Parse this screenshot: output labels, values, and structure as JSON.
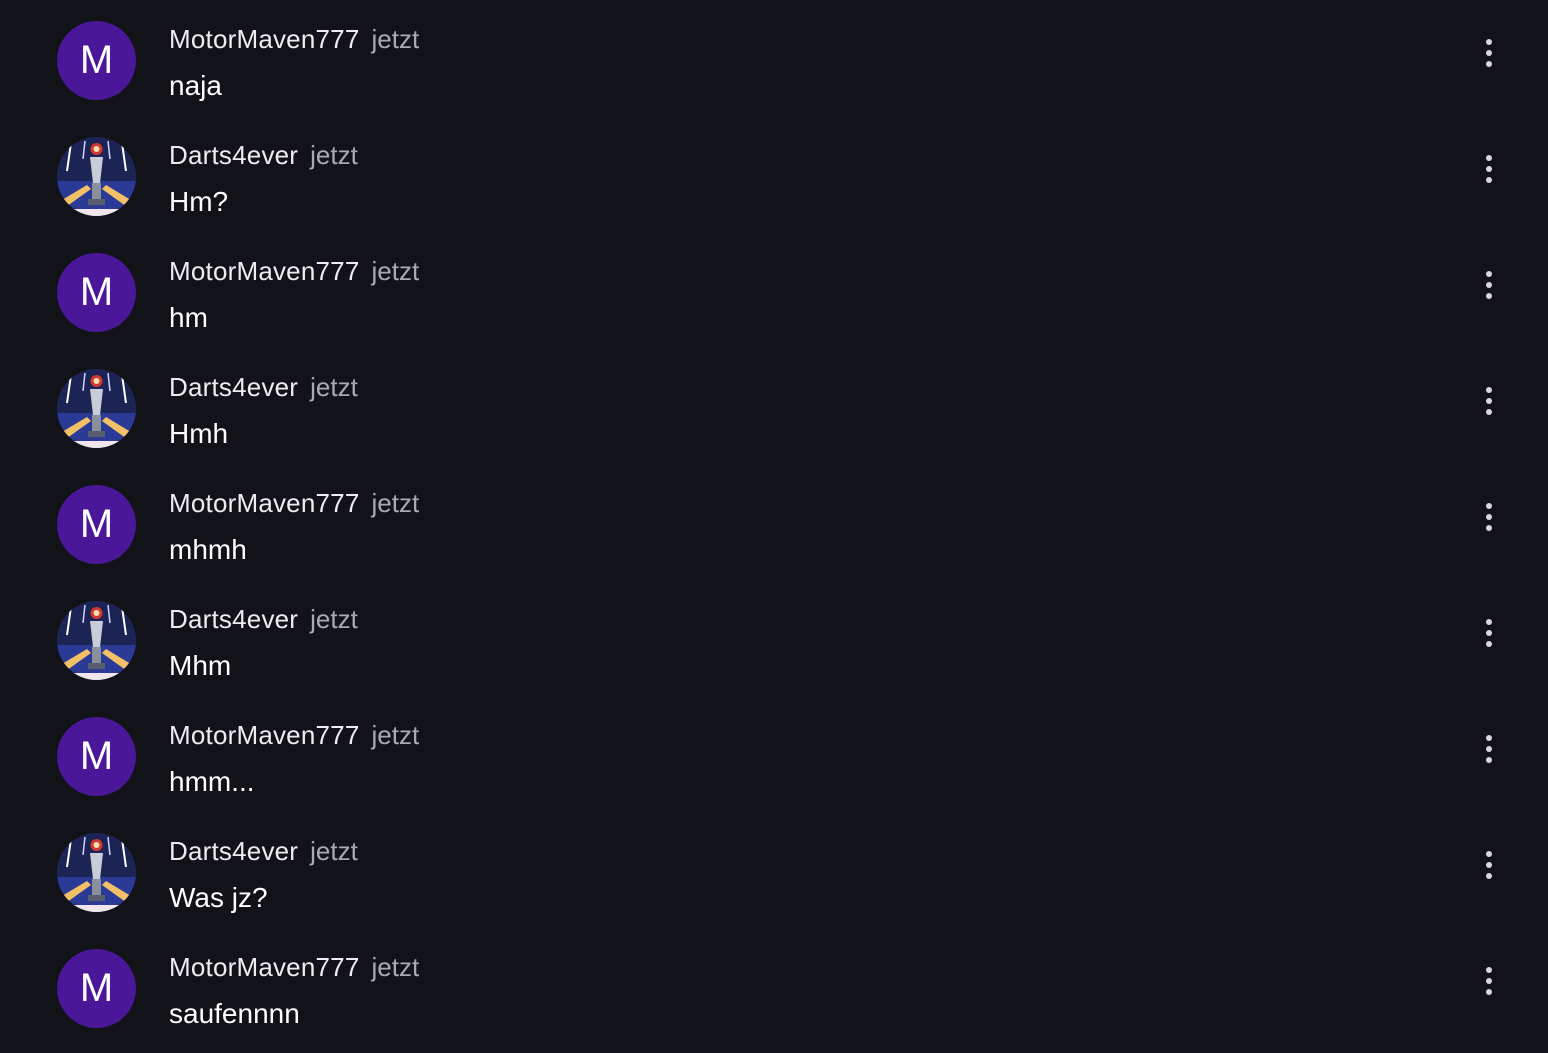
{
  "users": {
    "motor": {
      "name": "MotorMaven777",
      "initial": "M",
      "avatar_color": "#4a1798"
    },
    "darts": {
      "name": "Darts4ever",
      "avatar_icon": "darts-trophy-avatar"
    }
  },
  "messages": [
    {
      "user": "MotorMaven777",
      "avatar": "letter",
      "initial": "M",
      "time": "jetzt",
      "text": "naja"
    },
    {
      "user": "Darts4ever",
      "avatar": "image",
      "time": "jetzt",
      "text": "Hm?"
    },
    {
      "user": "MotorMaven777",
      "avatar": "letter",
      "initial": "M",
      "time": "jetzt",
      "text": "hm"
    },
    {
      "user": "Darts4ever",
      "avatar": "image",
      "time": "jetzt",
      "text": "Hmh"
    },
    {
      "user": "MotorMaven777",
      "avatar": "letter",
      "initial": "M",
      "time": "jetzt",
      "text": "mhmh"
    },
    {
      "user": "Darts4ever",
      "avatar": "image",
      "time": "jetzt",
      "text": "Mhm"
    },
    {
      "user": "MotorMaven777",
      "avatar": "letter",
      "initial": "M",
      "time": "jetzt",
      "text": "hmm..."
    },
    {
      "user": "Darts4ever",
      "avatar": "image",
      "time": "jetzt",
      "text": "Was jz?"
    },
    {
      "user": "MotorMaven777",
      "avatar": "letter",
      "initial": "M",
      "time": "jetzt",
      "text": "saufennnn"
    }
  ],
  "colors": {
    "background": "#121219",
    "username": "#ececf1",
    "timestamp": "#a9a9b2",
    "message_text": "#ffffff",
    "more_icon": "#d8d8de"
  },
  "icons": {
    "more": "more-vertical-icon"
  }
}
